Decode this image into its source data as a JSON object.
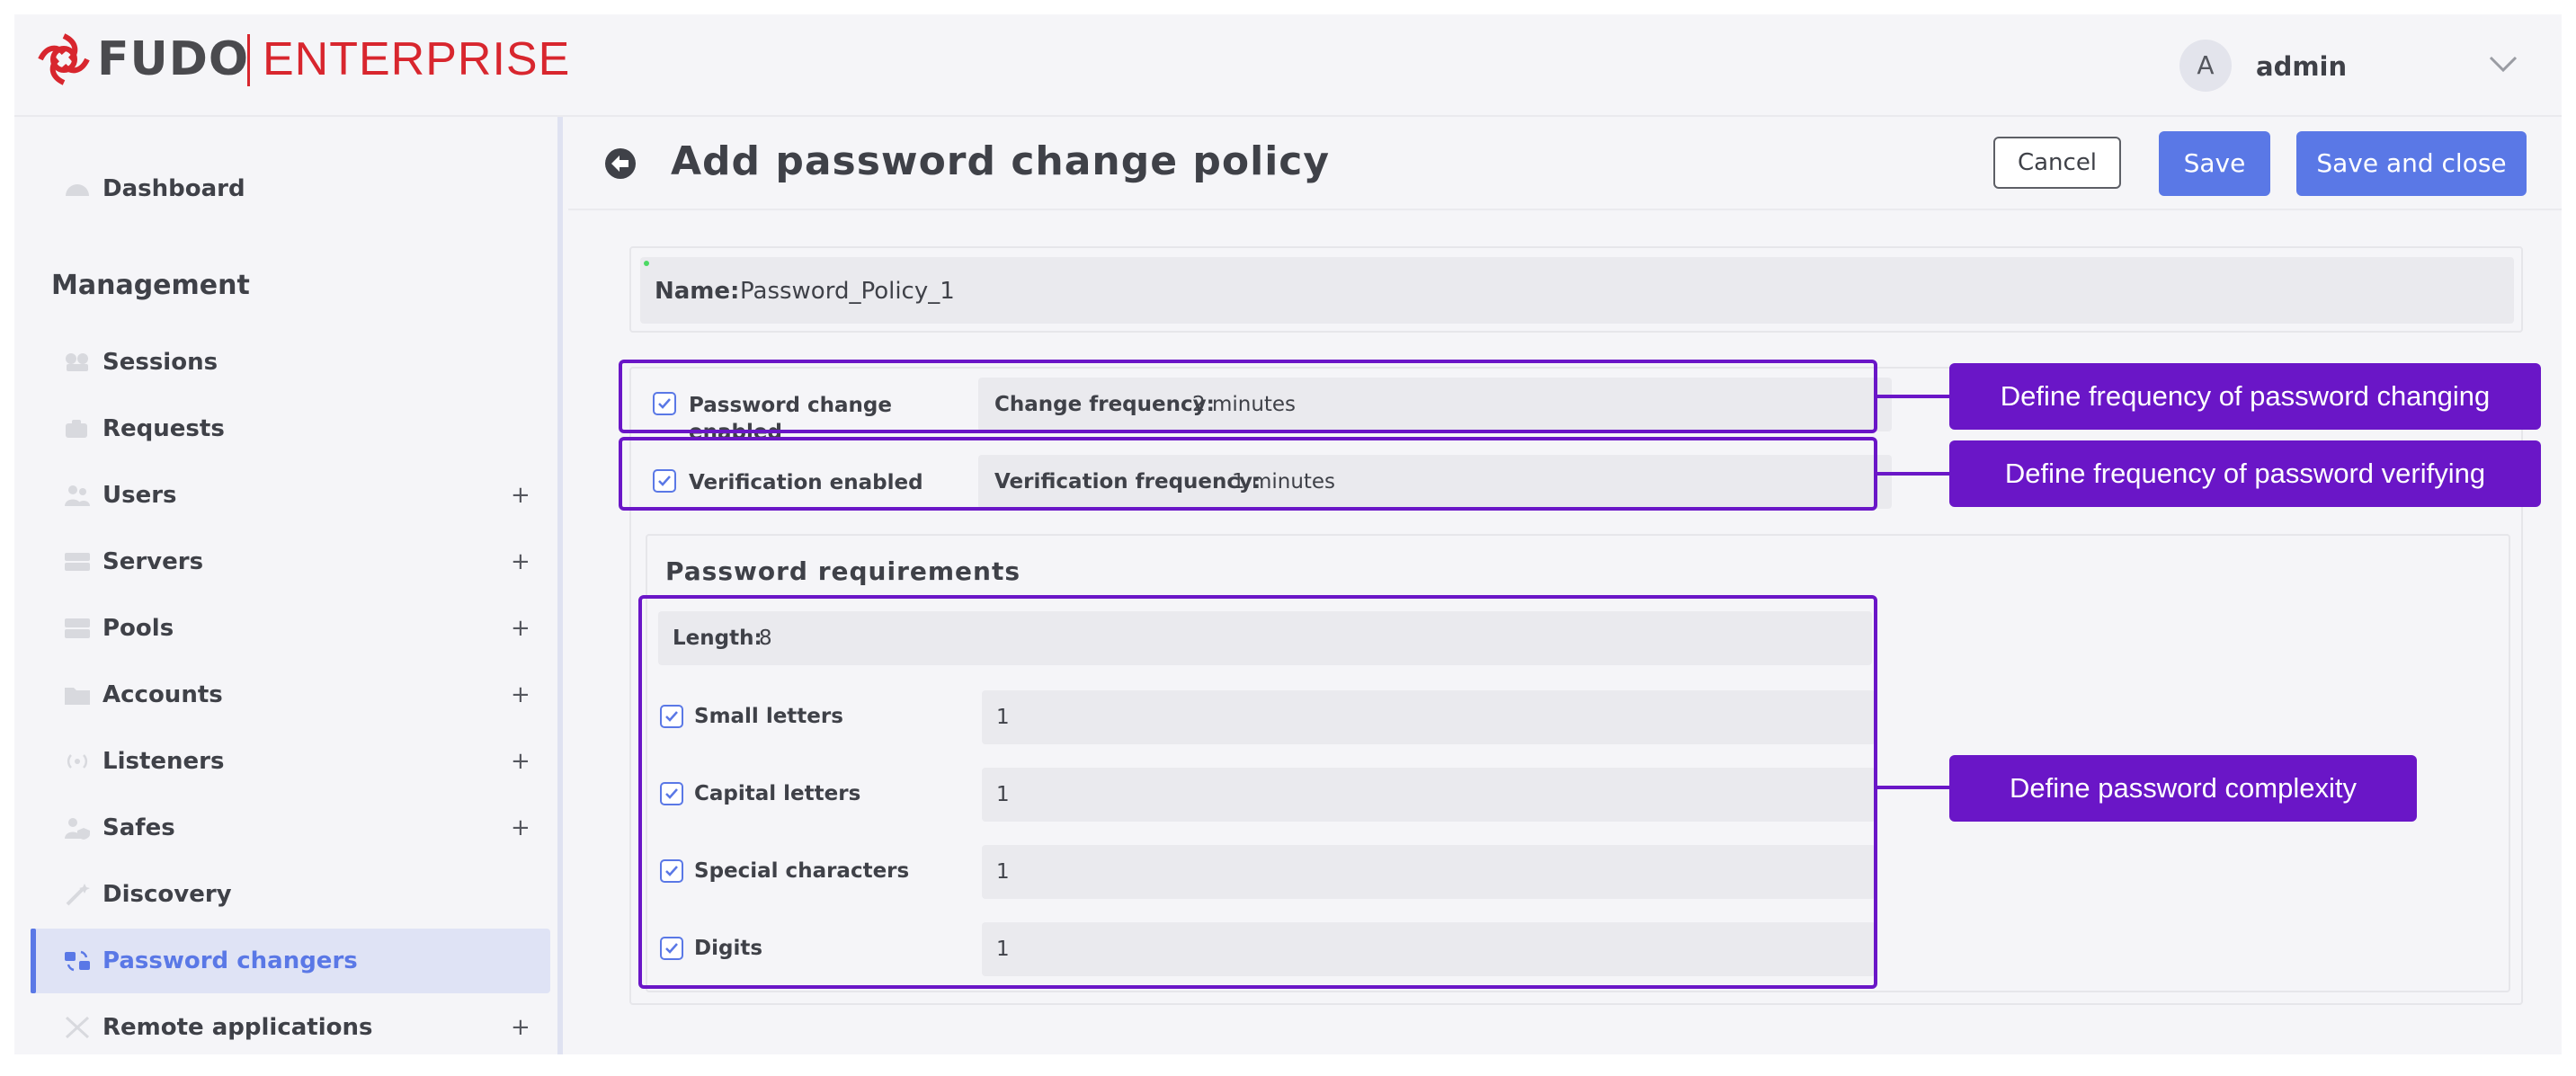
{
  "header": {
    "brand_name": "FUDO",
    "brand_product": "ENTERPRISE",
    "user_initial": "A",
    "username": "admin",
    "colors": {
      "brand_red": "#d8262e",
      "accent": "#5a78e6",
      "annotation": "#6a16c7"
    }
  },
  "sidebar": {
    "dashboard": "Dashboard",
    "section_title": "Management",
    "items": [
      {
        "label": "Sessions",
        "icon": "sessions-icon",
        "expandable": false
      },
      {
        "label": "Requests",
        "icon": "requests-icon",
        "expandable": false
      },
      {
        "label": "Users",
        "icon": "users-icon",
        "expandable": true
      },
      {
        "label": "Servers",
        "icon": "servers-icon",
        "expandable": true
      },
      {
        "label": "Pools",
        "icon": "pools-icon",
        "expandable": true
      },
      {
        "label": "Accounts",
        "icon": "accounts-icon",
        "expandable": true
      },
      {
        "label": "Listeners",
        "icon": "listeners-icon",
        "expandable": true
      },
      {
        "label": "Safes",
        "icon": "safes-icon",
        "expandable": true
      },
      {
        "label": "Discovery",
        "icon": "discovery-icon",
        "expandable": false
      },
      {
        "label": "Password changers",
        "icon": "password-changers-icon",
        "expandable": false,
        "active": true
      },
      {
        "label": "Remote applications",
        "icon": "remote-applications-icon",
        "expandable": true
      }
    ],
    "plus": "+"
  },
  "main": {
    "title": "Add password change policy",
    "buttons": {
      "cancel": "Cancel",
      "save": "Save",
      "save_close": "Save and close"
    },
    "name_label": "Name:",
    "name_value": "Password_Policy_1",
    "password_change": {
      "checkbox_label": "Password change enabled",
      "checked": true,
      "freq_label": "Change frequency:",
      "freq_value": "2 minutes"
    },
    "verification": {
      "checkbox_label": "Verification enabled",
      "checked": true,
      "freq_label": "Verification frequency:",
      "freq_value": "1 minutes"
    },
    "requirements": {
      "title": "Password requirements",
      "length_label": "Length:",
      "length_value": "8",
      "rows": [
        {
          "label": "Small letters",
          "checked": true,
          "value": "1"
        },
        {
          "label": "Capital letters",
          "checked": true,
          "value": "1"
        },
        {
          "label": "Special characters",
          "checked": true,
          "value": "1"
        },
        {
          "label": "Digits",
          "checked": true,
          "value": "1"
        }
      ]
    }
  },
  "annotations": {
    "change_frequency": "Define frequency of password changing",
    "verify_frequency": "Define frequency of password verifying",
    "complexity": "Define password complexity"
  }
}
